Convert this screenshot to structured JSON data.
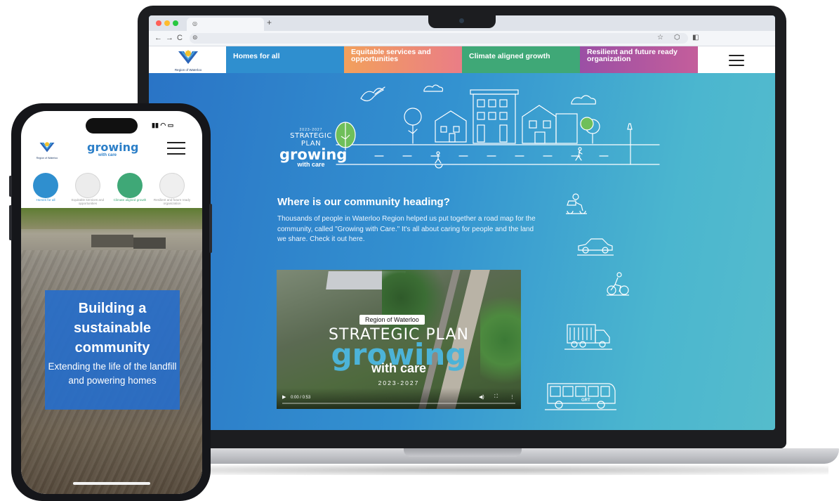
{
  "browser": {
    "tab_icon": "globe-icon",
    "new_tab": "+",
    "nav": {
      "back": "←",
      "forward": "→",
      "reload": "C"
    },
    "icons": [
      "star-icon",
      "extension-icon",
      "sidebar-icon"
    ]
  },
  "site_nav": {
    "logo_caption": "Region of Waterloo",
    "tabs": [
      {
        "label": "Homes for all",
        "color": "#2f8fcf"
      },
      {
        "label": "Equitable services and opportunities",
        "color": "#f08a6a"
      },
      {
        "label": "Climate aligned growth",
        "color": "#3fa877"
      },
      {
        "label": "Resilient and future ready organization",
        "color": "#a4559f"
      }
    ]
  },
  "hero": {
    "plan_years": "2023-2027",
    "plan_title": "STRATEGIC PLAN",
    "plan_growing": "growing",
    "plan_care": "with care",
    "heading": "Where is our community heading?",
    "body": "Thousands of people in Waterloo Region helped us put together a road map for the community, called \"Growing with Care.\" It's all about caring for people and the land we share. Check it out here."
  },
  "video": {
    "badge": "Region of Waterloo",
    "title": "STRATEGIC PLAN",
    "growing": "growing",
    "care": "with care",
    "years": "2023-2027",
    "time": "0:00 / 0:53",
    "progress": 0.0
  },
  "phone": {
    "status_icons": "signal wifi battery",
    "logo_caption": "Region of Waterloo",
    "growing": "growing",
    "care": "with care",
    "categories": [
      {
        "label": "Homes for all",
        "color": "#2f8fcf",
        "active": true
      },
      {
        "label": "Equitable services and opportunities",
        "color": "#cfcfcf",
        "active": false
      },
      {
        "label": "Climate aligned growth",
        "color": "#3fa877",
        "active": true
      },
      {
        "label": "Resilient and future ready organization",
        "color": "#d5d5d5",
        "active": false
      }
    ],
    "card_title": "Building a sustainable community",
    "card_sub": "Extending the life of the landfill and powering homes"
  },
  "colors": {
    "hero_start": "#2a74c6",
    "hero_end": "#55bccc",
    "accent_blue": "#2c7fc8"
  }
}
